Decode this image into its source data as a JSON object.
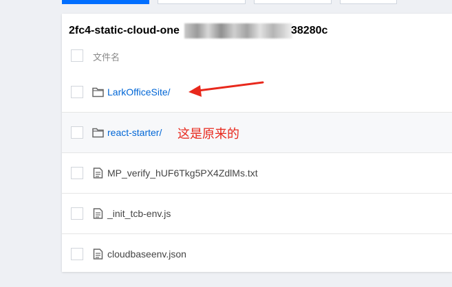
{
  "bucket": {
    "title_prefix": "2fc4-static-cloud-one",
    "title_suffix": "38280c"
  },
  "table": {
    "header_label": "文件名"
  },
  "files": [
    {
      "name": "LarkOfficeSite/",
      "type": "folder",
      "icon": "folder-icon"
    },
    {
      "name": "react-starter/",
      "type": "folder",
      "icon": "folder-icon"
    },
    {
      "name": "MP_verify_hUF6Tkg5PX4ZdlMs.txt",
      "type": "file",
      "icon": "document-icon"
    },
    {
      "name": "_init_tcb-env.js",
      "type": "file",
      "icon": "document-icon"
    },
    {
      "name": "cloudbaseenv.json",
      "type": "file",
      "icon": "document-icon"
    }
  ],
  "annotation": {
    "text": "这是原来的",
    "color": "#e8281c"
  },
  "colors": {
    "accent": "#006eff",
    "link": "#0066d6"
  }
}
